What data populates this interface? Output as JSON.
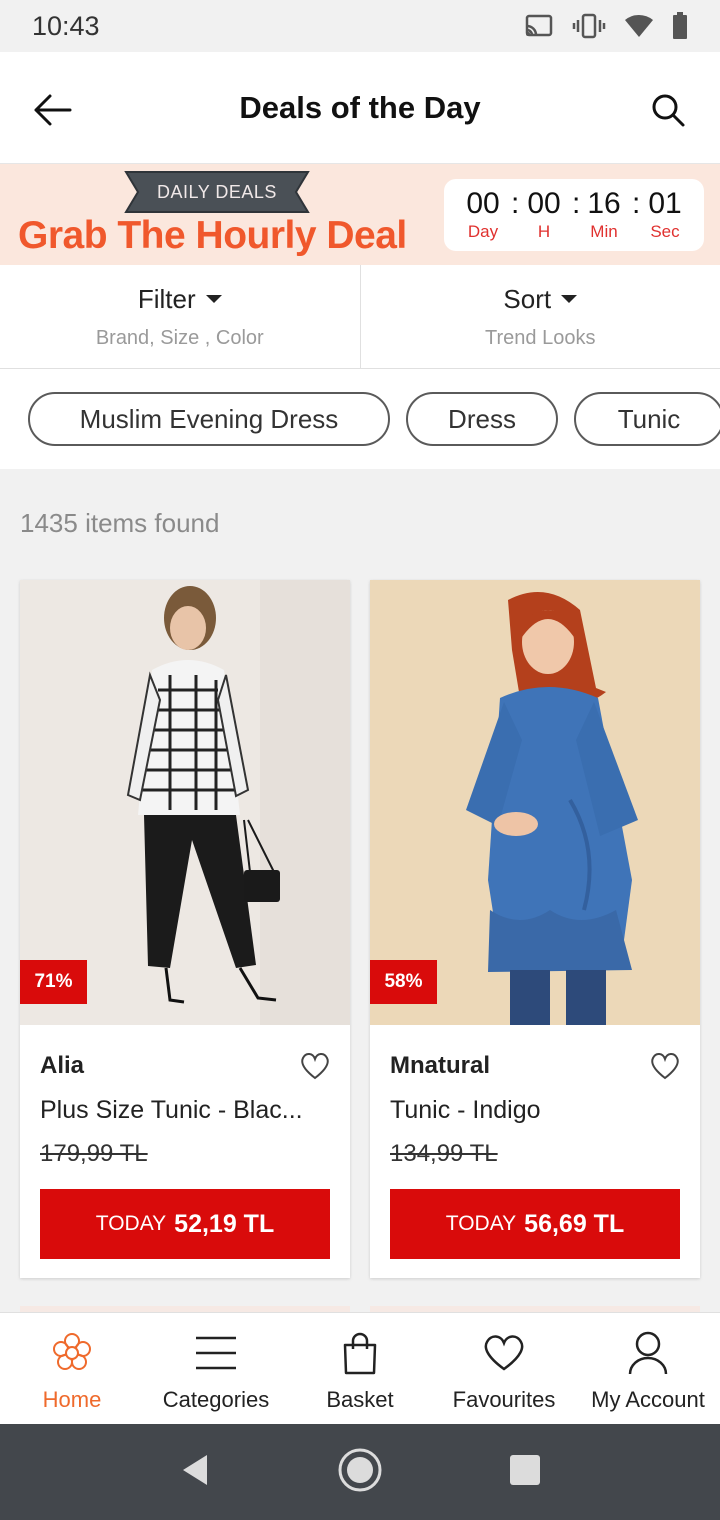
{
  "status_bar": {
    "time": "10:43",
    "icons": [
      "cast-icon",
      "vibrate-icon",
      "wifi-icon",
      "battery-icon"
    ]
  },
  "app_bar": {
    "title": "Deals of the Day",
    "back_icon": "arrow-left-icon",
    "search_icon": "search-icon"
  },
  "banner": {
    "ribbon": "DAILY DEALS",
    "headline": "Grab The Hourly Deal",
    "headline_color": "#f0582c",
    "countdown": [
      {
        "value": "00",
        "label": "Day"
      },
      {
        "value": "00",
        "label": "H"
      },
      {
        "value": "16",
        "label": "Min"
      },
      {
        "value": "01",
        "label": "Sec"
      }
    ],
    "separator": ":"
  },
  "filter": {
    "title": "Filter",
    "subtitle": "Brand, Size , Color"
  },
  "sort": {
    "title": "Sort",
    "subtitle": "Trend Looks"
  },
  "chips": [
    "Muslim Evening Dress",
    "Dress",
    "Tunic"
  ],
  "results": {
    "count_text": "1435 items found"
  },
  "products": [
    {
      "discount": "71%",
      "brand": "Alia",
      "title": "Plus Size Tunic - Blac...",
      "old_price": "179,99 TL",
      "today_label": "TODAY",
      "today_price": "52,19 TL"
    },
    {
      "discount": "58%",
      "brand": "Mnatural",
      "title": "Tunic - Indigo",
      "old_price": "134,99 TL",
      "today_label": "TODAY",
      "today_price": "56,69 TL"
    }
  ],
  "bottom_nav": [
    {
      "label": "Home",
      "icon": "flower-home-icon",
      "active": true
    },
    {
      "label": "Categories",
      "icon": "menu-icon",
      "active": false
    },
    {
      "label": "Basket",
      "icon": "shopping-bag-icon",
      "active": false
    },
    {
      "label": "Favourites",
      "icon": "heart-icon",
      "active": false
    },
    {
      "label": "My Account",
      "icon": "user-icon",
      "active": false
    }
  ],
  "colors": {
    "accent": "#d90b0b",
    "brand_orange": "#ef6a2c",
    "timer_label": "#e0312f"
  }
}
